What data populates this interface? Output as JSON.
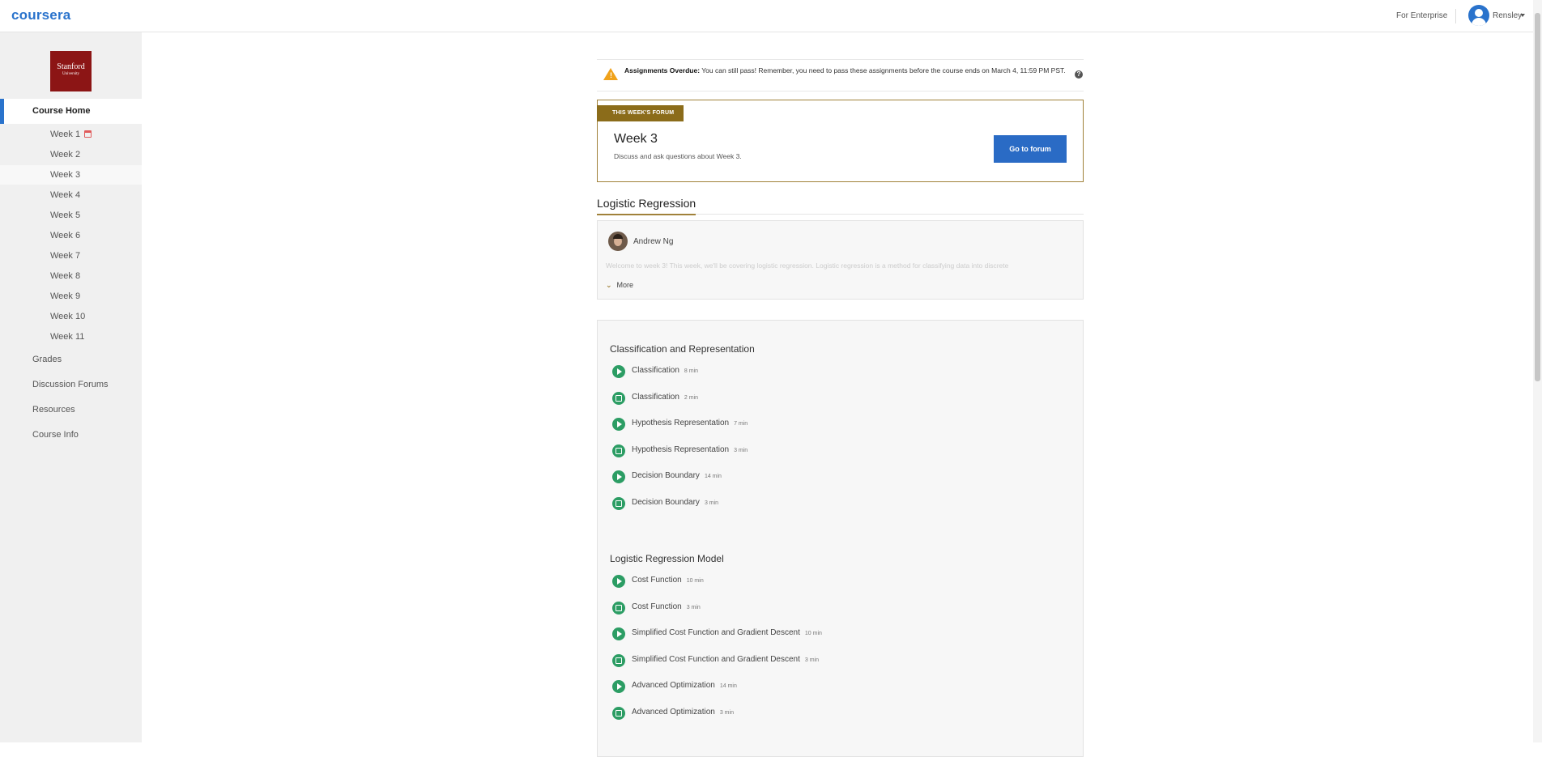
{
  "header": {
    "logo": "coursera",
    "enterprise_link": "For Enterprise",
    "username": "Rensley"
  },
  "sidebar": {
    "university_logo": {
      "line1": "Stanford",
      "line2": "University"
    },
    "course_home": "Course Home",
    "weeks": [
      "Week 1",
      "Week 2",
      "Week 3",
      "Week 4",
      "Week 5",
      "Week 6",
      "Week 7",
      "Week 8",
      "Week 9",
      "Week 10",
      "Week 11"
    ],
    "active_week": "Week 3",
    "links": [
      "Grades",
      "Discussion Forums",
      "Resources",
      "Course Info"
    ]
  },
  "alert": {
    "title": "Assignments Overdue:",
    "message": "You can still pass! Remember, you need to pass these assignments before the course ends on March 4, 11:59 PM PST.",
    "help_icon": "question-icon",
    "color": "#f0a21b"
  },
  "forum": {
    "tag": "THIS WEEK'S FORUM",
    "week": "Week 3",
    "description": "Discuss and ask questions about Week 3.",
    "button": "Go to forum"
  },
  "module": {
    "title": "Logistic Regression",
    "instructor_name": "Andrew Ng",
    "intro_preview": "Welcome to week 3! This week, we'll be covering logistic regression. Logistic regression is a method for classifying data into discrete",
    "more_label": "More"
  },
  "lesson_groups": [
    {
      "title": "Classification and Representation",
      "items": [
        {
          "type": "video",
          "name": "Classification",
          "duration": "8 min"
        },
        {
          "type": "reading",
          "name": "Classification",
          "duration": "2 min"
        },
        {
          "type": "video",
          "name": "Hypothesis Representation",
          "duration": "7 min"
        },
        {
          "type": "reading",
          "name": "Hypothesis Representation",
          "duration": "3 min"
        },
        {
          "type": "video",
          "name": "Decision Boundary",
          "duration": "14 min"
        },
        {
          "type": "reading",
          "name": "Decision Boundary",
          "duration": "3 min"
        }
      ]
    },
    {
      "title": "Logistic Regression Model",
      "items": [
        {
          "type": "video",
          "name": "Cost Function",
          "duration": "10 min"
        },
        {
          "type": "reading",
          "name": "Cost Function",
          "duration": "3 min"
        },
        {
          "type": "video",
          "name": "Simplified Cost Function and Gradient Descent",
          "duration": "10 min"
        },
        {
          "type": "reading",
          "name": "Simplified Cost Function and Gradient Descent",
          "duration": "3 min"
        },
        {
          "type": "video",
          "name": "Advanced Optimization",
          "duration": "14 min"
        },
        {
          "type": "reading",
          "name": "Advanced Optimization",
          "duration": "3 min"
        }
      ]
    }
  ],
  "colors": {
    "brand": "#2a73cc",
    "accent_gold": "#a0813a",
    "complete_green": "#2c9d64",
    "stanford_red": "#8c1515"
  }
}
